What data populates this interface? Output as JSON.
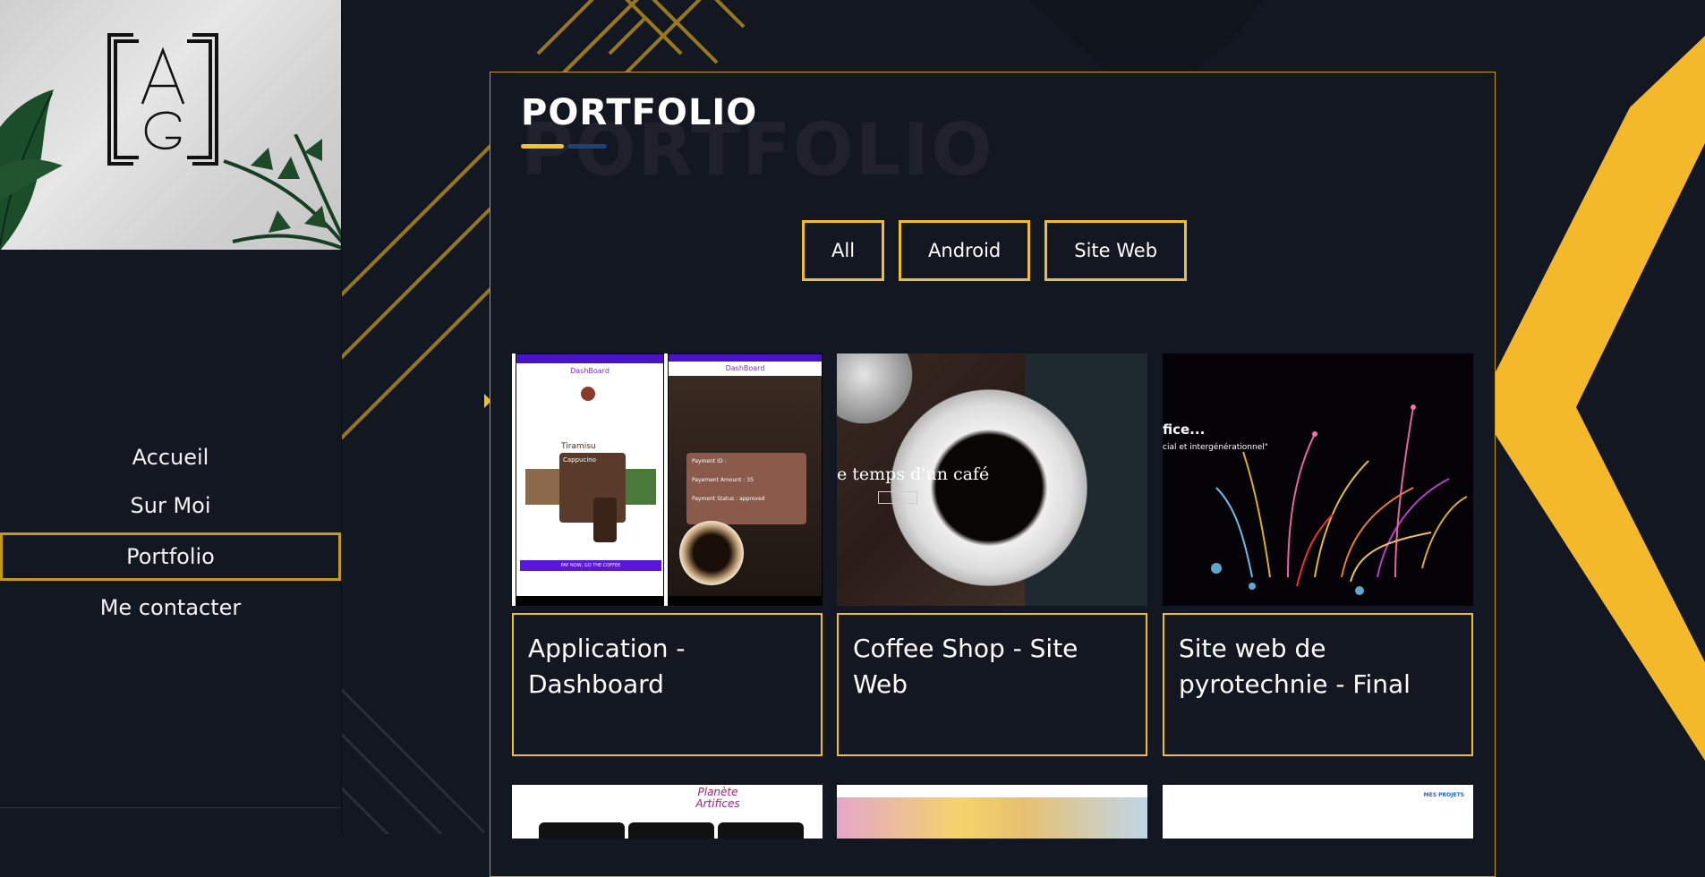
{
  "sidebar": {
    "logo_letters": "AG",
    "nav": [
      {
        "label": "Accueil",
        "active": false
      },
      {
        "label": "Sur Moi",
        "active": false
      },
      {
        "label": "Portfolio",
        "active": true
      },
      {
        "label": "Me contacter",
        "active": false
      }
    ]
  },
  "portfolio": {
    "title": "PORTFOLIO",
    "title_watermark": "PORTFOLIO",
    "filters": [
      "All",
      "Android",
      "Site Web"
    ],
    "projects": [
      {
        "title": "Application - Dashboard",
        "thumb": {
          "header": "DashBoard",
          "header_right": "DashBoard",
          "card_title": "Tiramisu",
          "card_sub": "Cappucino",
          "pay_button": "PAY NOW, GO THE COFFEE",
          "payment_id": "Payment ID :",
          "payment_amount": "Payement Amount : 35",
          "payment_status": "Payment Status : approved"
        }
      },
      {
        "title": "Coffee Shop - Site Web",
        "thumb": {
          "tagline": "e temps d'un café"
        }
      },
      {
        "title": "Site web de pyrotechnie - Final",
        "thumb": {
          "heading": "fice...",
          "subheading": "cial et intergénérationnel\""
        }
      }
    ],
    "row2": [
      {
        "caption": "Planète Artifices"
      },
      {
        "caption": ""
      },
      {
        "caption": "MES PROJETS"
      }
    ]
  },
  "colors": {
    "background": "#131722",
    "accent": "#f0bf26",
    "accent_dark": "#c99a13",
    "underline_blue": "#1f3f7a"
  }
}
